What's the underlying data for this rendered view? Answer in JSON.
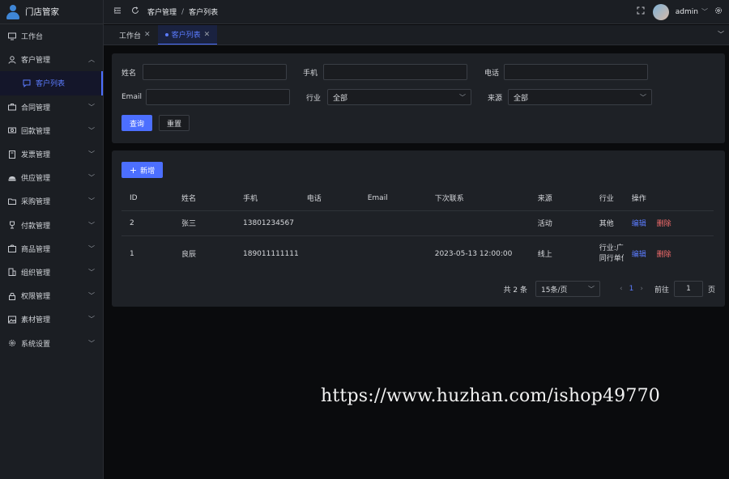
{
  "app": {
    "title": "门店管家"
  },
  "sidebar": {
    "items": [
      {
        "label": "工作台",
        "icon": "monitor-icon"
      },
      {
        "label": "客户管理",
        "icon": "user-icon",
        "expanded": true
      },
      {
        "label": "客户列表",
        "icon": "chat-icon",
        "active": true
      },
      {
        "label": "合同管理",
        "icon": "briefcase-icon"
      },
      {
        "label": "回款管理",
        "icon": "money-icon"
      },
      {
        "label": "发票管理",
        "icon": "notebook-icon"
      },
      {
        "label": "供应管理",
        "icon": "hat-icon"
      },
      {
        "label": "采购管理",
        "icon": "folder-icon"
      },
      {
        "label": "付款管理",
        "icon": "trophy-icon"
      },
      {
        "label": "商品管理",
        "icon": "goods-icon"
      },
      {
        "label": "组织管理",
        "icon": "office-icon"
      },
      {
        "label": "权限管理",
        "icon": "lock-icon"
      },
      {
        "label": "素材管理",
        "icon": "picture-icon"
      },
      {
        "label": "系统设置",
        "icon": "gear-icon"
      }
    ]
  },
  "header": {
    "breadcrumb": [
      "客户管理",
      "客户列表"
    ],
    "breadcrumb_sep": "/",
    "username": "admin"
  },
  "tabs": [
    {
      "label": "工作台"
    },
    {
      "label": "客户列表",
      "active": true
    }
  ],
  "search": {
    "name_label": "姓名",
    "mobile_label": "手机",
    "phone_label": "电话",
    "email_label": "Email",
    "industry_label": "行业",
    "industry_value": "全部",
    "source_label": "来源",
    "source_value": "全部",
    "query_button": "查询",
    "reset_button": "重置"
  },
  "table": {
    "add_button": "新增",
    "add_icon": "+",
    "columns": [
      "ID",
      "姓名",
      "手机",
      "电话",
      "Email",
      "下次联系",
      "来源",
      "行业",
      "操作"
    ],
    "rows": [
      {
        "id": "2",
        "name": "张三",
        "mobile": "13801234567",
        "phone": "",
        "email": "",
        "next": "",
        "source": "活动",
        "industry": "其他"
      },
      {
        "id": "1",
        "name": "良辰",
        "mobile": "189011111111",
        "phone": "",
        "email": "",
        "next": "2023-05-13 12:00:00",
        "source": "线上",
        "industry": "行业:广",
        "industry2": "同行单位"
      }
    ],
    "edit_label": "编辑",
    "delete_label": "删除"
  },
  "pagination": {
    "total": "共 2 条",
    "page_size": "15条/页",
    "current": "1",
    "goto_label": "前往",
    "goto_value": "1",
    "page_unit": "页"
  },
  "watermark": "https://www.huzhan.com/ishop49770",
  "colors": {
    "accent": "#4c6fff",
    "danger": "#f56c6c",
    "background": "#0a0b0d",
    "panel": "#1e2126"
  }
}
